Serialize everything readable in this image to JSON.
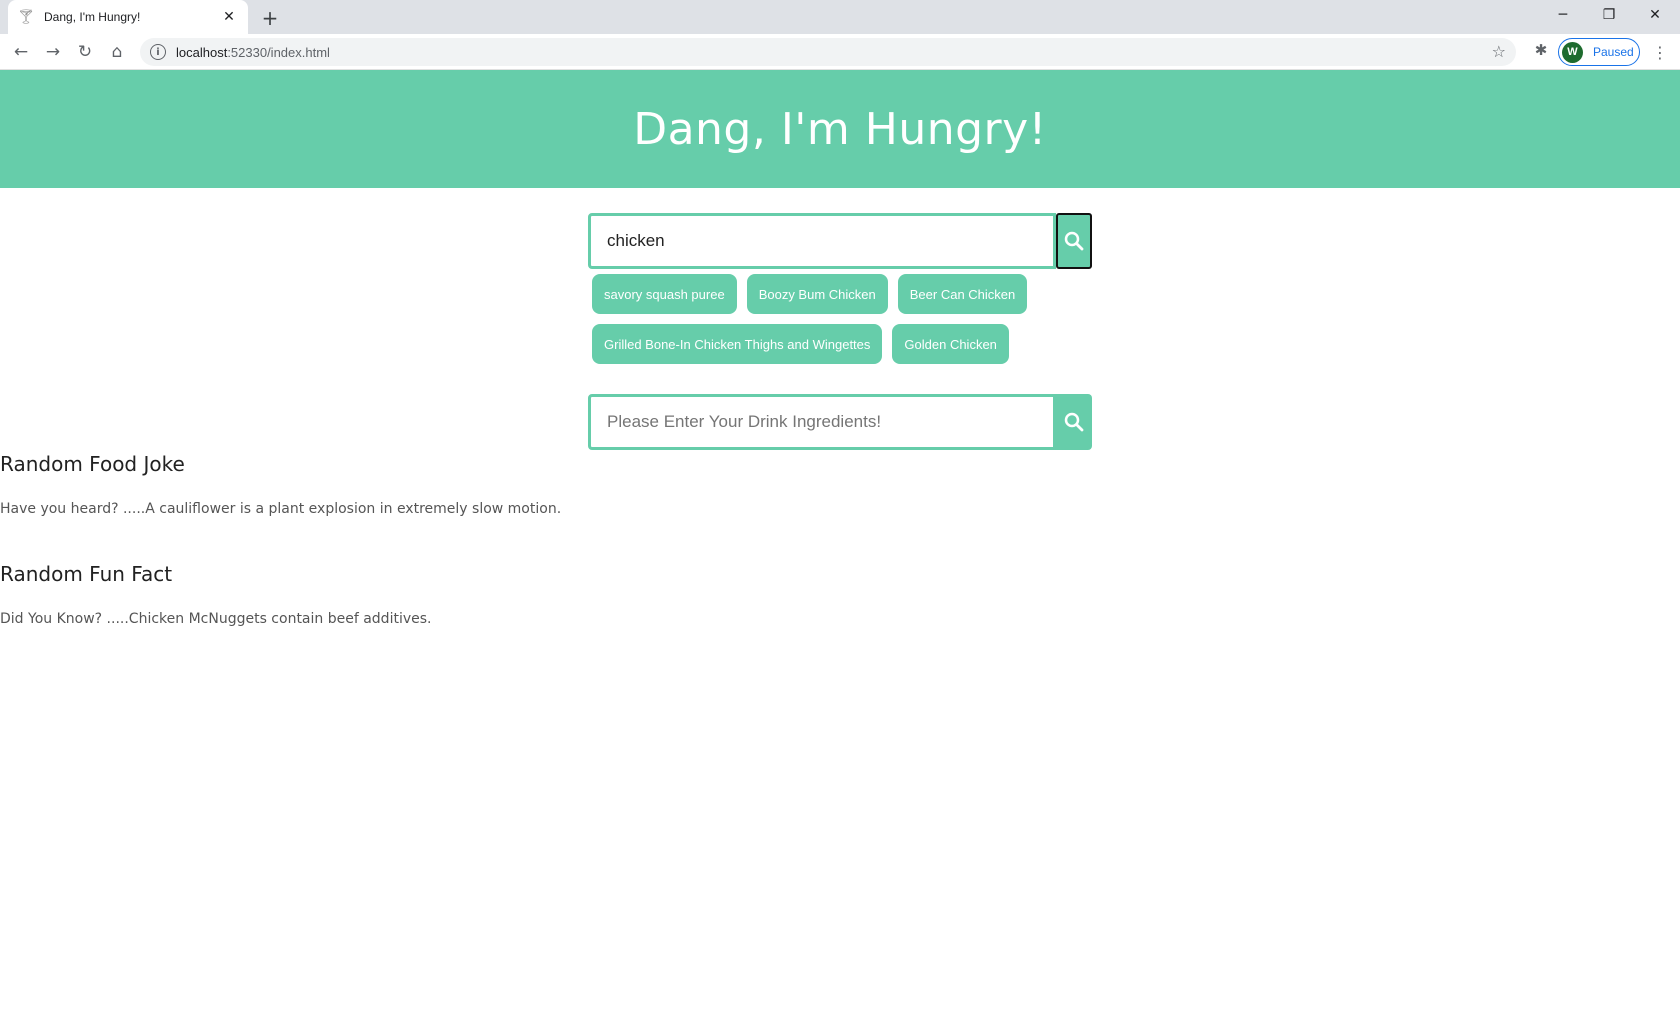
{
  "browser": {
    "tab_title": "Dang, I'm Hungry!",
    "url_host": "localhost",
    "url_path": ":52330/index.html",
    "profile_initial": "W",
    "profile_status": "Paused"
  },
  "header": {
    "title": "Dang, I'm Hungry!"
  },
  "food_search": {
    "value": "chicken",
    "placeholder": ""
  },
  "suggestions": {
    "row1": [
      "savory squash puree",
      "Boozy Bum Chicken",
      "Beer Can Chicken"
    ],
    "row2": [
      "Grilled Bone-In Chicken Thighs and Wingettes",
      "Golden Chicken"
    ]
  },
  "drink_search": {
    "value": "",
    "placeholder": "Please Enter Your Drink Ingredients!"
  },
  "joke": {
    "heading": "Random Food Joke",
    "text": "Have you heard? .....A cauliflower is a plant explosion in extremely slow motion."
  },
  "fact": {
    "heading": "Random Fun Fact",
    "text": "Did You Know? .....Chicken McNuggets contain beef additives."
  },
  "colors": {
    "accent": "#66cdaa"
  }
}
